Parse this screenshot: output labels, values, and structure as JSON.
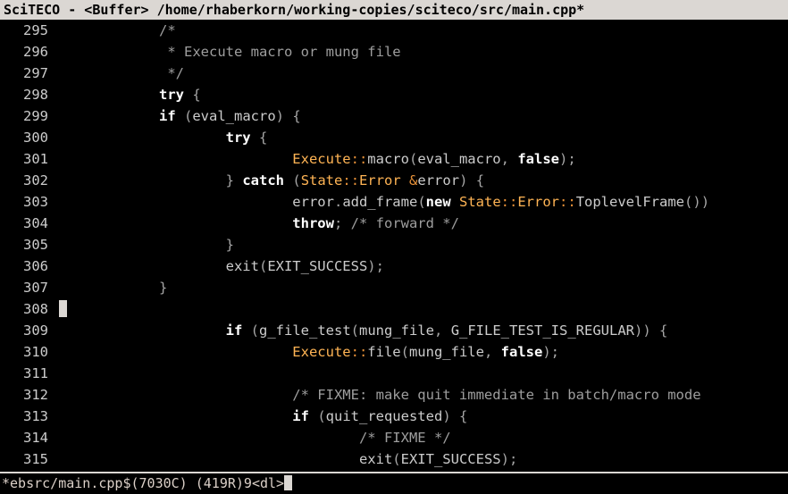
{
  "title": "SciTECO - <Buffer> /home/rhaberkorn/working-copies/sciteco/src/main.cpp*",
  "statusbar": "*ebsrc/main.cpp$(7030C) (419R)9<dl>",
  "lines": [
    {
      "n": 295,
      "tokens": [
        [
          "sp",
          "            "
        ],
        [
          "comment",
          "/*"
        ]
      ]
    },
    {
      "n": 296,
      "tokens": [
        [
          "sp",
          "             "
        ],
        [
          "comment",
          "* Execute macro or mung file"
        ]
      ]
    },
    {
      "n": 297,
      "tokens": [
        [
          "sp",
          "             "
        ],
        [
          "comment",
          "*/"
        ]
      ]
    },
    {
      "n": 298,
      "tokens": [
        [
          "sp",
          "            "
        ],
        [
          "kw",
          "try"
        ],
        [
          "sp",
          " "
        ],
        [
          "p",
          "{"
        ]
      ]
    },
    {
      "n": 299,
      "tokens": [
        [
          "sp",
          "            "
        ],
        [
          "kw",
          "if"
        ],
        [
          "sp",
          " "
        ],
        [
          "p",
          "("
        ],
        [
          "id",
          "eval_macro"
        ],
        [
          "p",
          ")"
        ],
        [
          "sp",
          " "
        ],
        [
          "p",
          "{"
        ]
      ]
    },
    {
      "n": 300,
      "tokens": [
        [
          "sp",
          "                    "
        ],
        [
          "kw",
          "try"
        ],
        [
          "sp",
          " "
        ],
        [
          "p",
          "{"
        ]
      ]
    },
    {
      "n": 301,
      "tokens": [
        [
          "sp",
          "                            "
        ],
        [
          "ty",
          "Execute"
        ],
        [
          "op",
          "::"
        ],
        [
          "id",
          "macro"
        ],
        [
          "p",
          "("
        ],
        [
          "id",
          "eval_macro"
        ],
        [
          "p",
          ","
        ],
        [
          "sp",
          " "
        ],
        [
          "kw",
          "false"
        ],
        [
          "p",
          ")"
        ],
        [
          "p",
          ";"
        ]
      ]
    },
    {
      "n": 302,
      "tokens": [
        [
          "sp",
          "                    "
        ],
        [
          "p",
          "}"
        ],
        [
          "sp",
          " "
        ],
        [
          "kw",
          "catch"
        ],
        [
          "sp",
          " "
        ],
        [
          "p",
          "("
        ],
        [
          "ty",
          "State"
        ],
        [
          "op",
          "::"
        ],
        [
          "ty",
          "Error"
        ],
        [
          "sp",
          " "
        ],
        [
          "op",
          "&"
        ],
        [
          "id",
          "error"
        ],
        [
          "p",
          ")"
        ],
        [
          "sp",
          " "
        ],
        [
          "p",
          "{"
        ]
      ]
    },
    {
      "n": 303,
      "tokens": [
        [
          "sp",
          "                            "
        ],
        [
          "id",
          "error"
        ],
        [
          "p",
          "."
        ],
        [
          "id",
          "add_frame"
        ],
        [
          "p",
          "("
        ],
        [
          "kw",
          "new"
        ],
        [
          "sp",
          " "
        ],
        [
          "ty",
          "State"
        ],
        [
          "op",
          "::"
        ],
        [
          "ty",
          "Error"
        ],
        [
          "op",
          "::"
        ],
        [
          "id",
          "ToplevelFrame"
        ],
        [
          "p",
          "("
        ],
        [
          "p",
          ")"
        ],
        [
          "p",
          ")"
        ]
      ]
    },
    {
      "n": 304,
      "tokens": [
        [
          "sp",
          "                            "
        ],
        [
          "kw",
          "throw"
        ],
        [
          "p",
          ";"
        ],
        [
          "sp",
          " "
        ],
        [
          "comment",
          "/* forward */"
        ]
      ]
    },
    {
      "n": 305,
      "tokens": [
        [
          "sp",
          "                    "
        ],
        [
          "p",
          "}"
        ]
      ]
    },
    {
      "n": 306,
      "tokens": [
        [
          "sp",
          "                    "
        ],
        [
          "id",
          "exit"
        ],
        [
          "p",
          "("
        ],
        [
          "id",
          "EXIT_SUCCESS"
        ],
        [
          "p",
          ")"
        ],
        [
          "p",
          ";"
        ]
      ]
    },
    {
      "n": 307,
      "tokens": [
        [
          "sp",
          "            "
        ],
        [
          "p",
          "}"
        ]
      ]
    },
    {
      "n": 308,
      "tokens": [
        [
          "cursor",
          ""
        ]
      ]
    },
    {
      "n": 309,
      "tokens": [
        [
          "sp",
          "                    "
        ],
        [
          "kw",
          "if"
        ],
        [
          "sp",
          " "
        ],
        [
          "p",
          "("
        ],
        [
          "id",
          "g_file_test"
        ],
        [
          "p",
          "("
        ],
        [
          "id",
          "mung_file"
        ],
        [
          "p",
          ","
        ],
        [
          "sp",
          " "
        ],
        [
          "id",
          "G_FILE_TEST_IS_REGULAR"
        ],
        [
          "p",
          ")"
        ],
        [
          "p",
          ")"
        ],
        [
          "sp",
          " "
        ],
        [
          "p",
          "{"
        ]
      ]
    },
    {
      "n": 310,
      "tokens": [
        [
          "sp",
          "                            "
        ],
        [
          "ty",
          "Execute"
        ],
        [
          "op",
          "::"
        ],
        [
          "id",
          "file"
        ],
        [
          "p",
          "("
        ],
        [
          "id",
          "mung_file"
        ],
        [
          "p",
          ","
        ],
        [
          "sp",
          " "
        ],
        [
          "kw",
          "false"
        ],
        [
          "p",
          ")"
        ],
        [
          "p",
          ";"
        ]
      ]
    },
    {
      "n": 311,
      "tokens": []
    },
    {
      "n": 312,
      "tokens": [
        [
          "sp",
          "                            "
        ],
        [
          "comment",
          "/* FIXME: make quit immediate in batch/macro mode"
        ]
      ]
    },
    {
      "n": 313,
      "tokens": [
        [
          "sp",
          "                            "
        ],
        [
          "kw",
          "if"
        ],
        [
          "sp",
          " "
        ],
        [
          "p",
          "("
        ],
        [
          "id",
          "quit_requested"
        ],
        [
          "p",
          ")"
        ],
        [
          "sp",
          " "
        ],
        [
          "p",
          "{"
        ]
      ]
    },
    {
      "n": 314,
      "tokens": [
        [
          "sp",
          "                                    "
        ],
        [
          "comment",
          "/* FIXME */"
        ]
      ]
    },
    {
      "n": 315,
      "tokens": [
        [
          "sp",
          "                                    "
        ],
        [
          "id",
          "exit"
        ],
        [
          "p",
          "("
        ],
        [
          "id",
          "EXIT_SUCCESS"
        ],
        [
          "p",
          ")"
        ],
        [
          "p",
          ";"
        ]
      ]
    }
  ]
}
